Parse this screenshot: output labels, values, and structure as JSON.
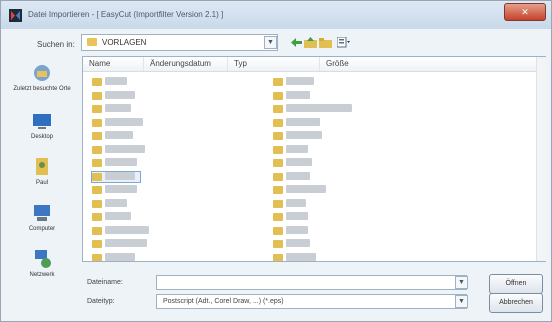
{
  "window": {
    "title": "Datei Importieren - [ EasyCut (Importfilter Version 2.1) ]",
    "close_glyph": "✕"
  },
  "toolbar": {
    "look_in_label": "Suchen in:",
    "look_in_value": "VORLAGEN",
    "icons": [
      "back-icon",
      "up-folder-icon",
      "new-folder-icon",
      "view-menu-icon"
    ]
  },
  "places": [
    {
      "label": "Zuletzt besuchte Orte",
      "icon": "recent-places-icon"
    },
    {
      "label": "Desktop",
      "icon": "desktop-icon"
    },
    {
      "label": "Paul",
      "icon": "user-folder-icon"
    },
    {
      "label": "Computer",
      "icon": "computer-icon"
    },
    {
      "label": "Netzwerk",
      "icon": "network-icon"
    }
  ],
  "columns": {
    "name": "Name",
    "date": "Änderungsdatum",
    "type": "Typ",
    "size": "Größe"
  },
  "files": {
    "column1_count": 14,
    "column2_count": 14,
    "selected_index": 7
  },
  "bottom": {
    "filename_label": "Dateiname:",
    "filename_value": "",
    "filetype_label": "Dateityp:",
    "filetype_value": "Postscript (Adt., Corel Draw, ...) (*.eps)",
    "open_button": "Öffnen",
    "cancel_button": "Abbrechen"
  },
  "colors": {
    "accent": "#7fa7d3",
    "folder": "#e2bf52",
    "close": "#c5422b"
  }
}
